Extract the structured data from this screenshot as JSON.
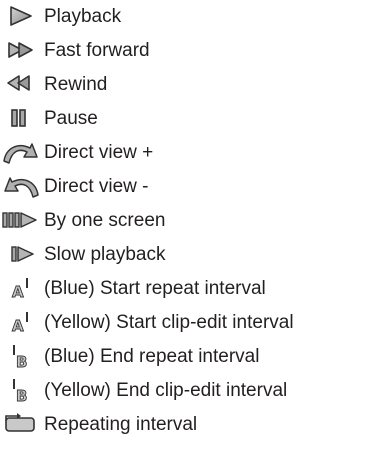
{
  "legend": {
    "items": [
      {
        "icon": "playback-icon",
        "label": "Playback"
      },
      {
        "icon": "fast-forward-icon",
        "label": "Fast forward"
      },
      {
        "icon": "rewind-icon",
        "label": "Rewind"
      },
      {
        "icon": "pause-icon",
        "label": "Pause"
      },
      {
        "icon": "direct-view-plus-icon",
        "label": "Direct view +"
      },
      {
        "icon": "direct-view-minus-icon",
        "label": "Direct view -"
      },
      {
        "icon": "by-one-screen-icon",
        "label": "By one screen"
      },
      {
        "icon": "slow-playback-icon",
        "label": "Slow playback"
      },
      {
        "icon": "start-interval-icon",
        "label": "(Blue) Start repeat interval"
      },
      {
        "icon": "start-interval-icon",
        "label": "(Yellow) Start clip-edit interval"
      },
      {
        "icon": "end-interval-icon",
        "label": "(Blue) End repeat interval"
      },
      {
        "icon": "end-interval-icon",
        "label": "(Yellow) End clip-edit interval"
      },
      {
        "icon": "repeating-interval-icon",
        "label": "Repeating interval"
      }
    ]
  }
}
